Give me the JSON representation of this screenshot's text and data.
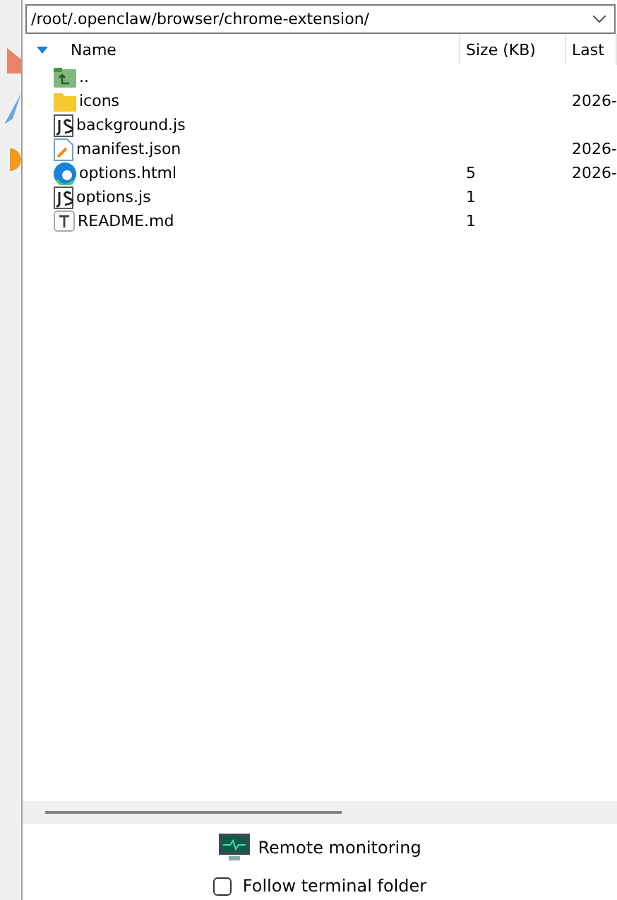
{
  "path_field": {
    "value": "/root/.openclaw/browser/chrome-extension/"
  },
  "columns": [
    "Name",
    "Size (KB)",
    "Last"
  ],
  "files": [
    {
      "kind": "parent",
      "name": ".."
    },
    {
      "kind": "folder",
      "name": "icons",
      "modified": "2026-"
    },
    {
      "kind": "js",
      "name": "background.js"
    },
    {
      "kind": "json",
      "name": "manifest.json",
      "modified": "2026-"
    },
    {
      "kind": "html",
      "name": "options.html",
      "size": "5",
      "modified": "2026-"
    },
    {
      "kind": "js",
      "name": "options.js",
      "size": "1"
    },
    {
      "kind": "text",
      "name": "README.md",
      "size": "1"
    }
  ],
  "remote_monitoring": {
    "label": "Remote monitoring"
  },
  "follow_folder": {
    "label": "Follow terminal folder",
    "checked": false
  }
}
